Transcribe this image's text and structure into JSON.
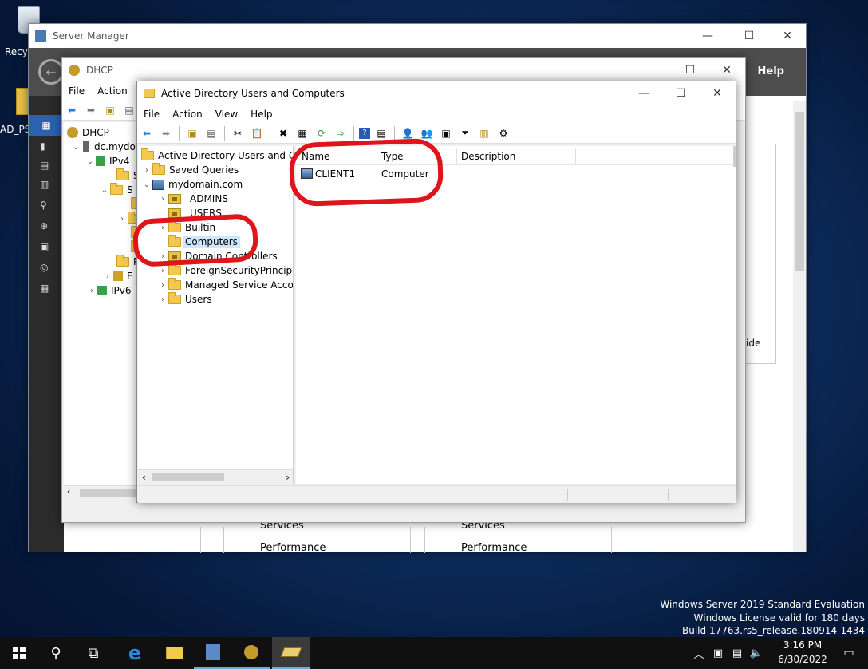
{
  "desktop": {
    "icons": [
      {
        "label": "Recyc"
      },
      {
        "label": "AD_PS"
      }
    ],
    "watermark": {
      "line1": "Windows Server 2019 Standard Evaluation",
      "line2": "Windows License valid for 180 days",
      "line3": "Build 17763.rs5_release.180914-1434"
    }
  },
  "server_manager": {
    "title": "Server Manager",
    "help": "Help",
    "fragment": "ide",
    "tiles": [
      {
        "services": "Services",
        "performance": "Performance"
      },
      {
        "services": "Services",
        "performance": "Performance"
      }
    ]
  },
  "dhcp": {
    "title": "DHCP",
    "menu": [
      "File",
      "Action"
    ],
    "tree": [
      "DHCP",
      "dc.mydo",
      "IPv4",
      "S",
      "S",
      "P",
      "F",
      "IPv6"
    ]
  },
  "aduc": {
    "title": "Active Directory Users and Computers",
    "menu": [
      "File",
      "Action",
      "View",
      "Help"
    ],
    "tree": {
      "root": "Active Directory Users and Com",
      "saved_queries": "Saved Queries",
      "domain": "mydomain.com",
      "children": [
        "_ADMINS",
        "_USERS",
        "Builtin",
        "Computers",
        "Domain Controllers",
        "ForeignSecurityPrincipals",
        "Managed Service Accour",
        "Users"
      ]
    },
    "list": {
      "columns": [
        "Name",
        "Type",
        "Description"
      ],
      "rows": [
        {
          "name": "CLIENT1",
          "type": "Computer",
          "description": ""
        }
      ]
    }
  },
  "taskbar": {
    "time": "3:16 PM",
    "date": "6/30/2022"
  },
  "colors": {
    "annotation": "#e0141b",
    "selection": "#cce8ff",
    "taskbar": "#101010"
  }
}
